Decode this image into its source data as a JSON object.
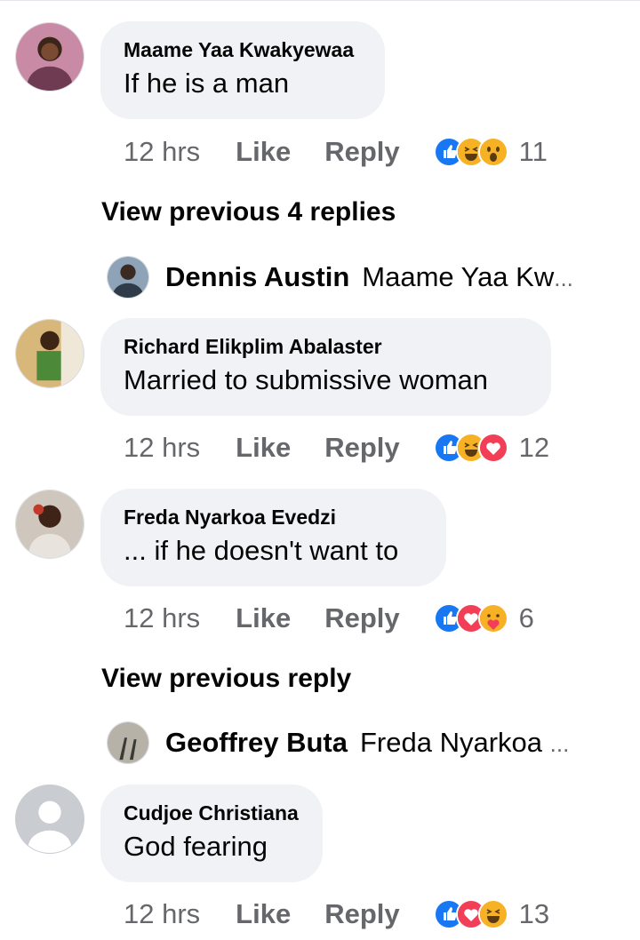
{
  "comments": [
    {
      "author": "Maame Yaa Kwakyewaa",
      "text": "If he is a man",
      "time": "12 hrs",
      "like": "Like",
      "reply": "Reply",
      "reaction_count": "11",
      "reactions": [
        "like-icon",
        "haha-icon",
        "wow-icon"
      ]
    },
    {
      "author": "Richard Elikplim Abalaster",
      "text": "Married to submissive woman",
      "time": "12 hrs",
      "like": "Like",
      "reply": "Reply",
      "reaction_count": "12",
      "reactions": [
        "like-icon",
        "haha-icon",
        "love-icon"
      ]
    },
    {
      "author": "Freda Nyarkoa Evedzi",
      "text": "... if he doesn't want to",
      "time": "12 hrs",
      "like": "Like",
      "reply": "Reply",
      "reaction_count": "6",
      "reactions": [
        "like-icon",
        "love-icon",
        "care-icon"
      ]
    },
    {
      "author": "Cudjoe Christiana",
      "text": "God fearing",
      "time": "12 hrs",
      "like": "Like",
      "reply": "Reply",
      "reaction_count": "13",
      "reactions": [
        "like-icon",
        "love-icon",
        "haha-icon"
      ]
    }
  ],
  "view_previous": [
    {
      "label": "View previous 4 replies",
      "reply_author": "Dennis Austin",
      "reply_snippet": "Maame Yaa Kw",
      "ellipsis": "..."
    },
    {
      "label": "View previous reply",
      "reply_author": "Geoffrey Buta",
      "reply_snippet": "Freda Nyarkoa ",
      "ellipsis": "..."
    }
  ],
  "colors": {
    "bubble": "#f0f2f5",
    "meta": "#65676b",
    "like_blue": "#1877f2",
    "love_red": "#f33e58",
    "haha_yellow": "#f7b125"
  }
}
